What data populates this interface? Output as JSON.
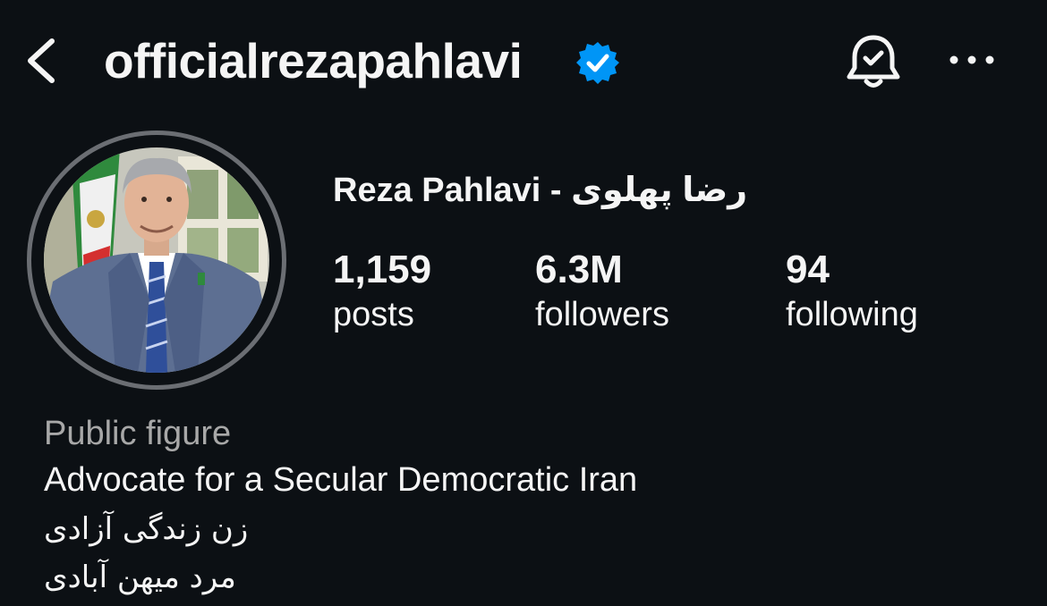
{
  "header": {
    "username": "officialrezapahlavi",
    "verified": true
  },
  "profile": {
    "full_name": "Reza Pahlavi - رضا پهلوی",
    "stats": [
      {
        "value": "1,159",
        "label": "posts"
      },
      {
        "value": "6.3M",
        "label": "followers"
      },
      {
        "value": "94",
        "label": "following"
      }
    ],
    "category": "Public figure",
    "bio_lines": [
      "Advocate for a Secular Democratic Iran",
      "زن زندگی آزادی",
      "مرد میهن آبادی"
    ]
  },
  "colors": {
    "background": "#0c1014",
    "text": "#f5f5f5",
    "secondary_text": "#a8a8a8",
    "verified_blue": "#0095f6",
    "avatar_ring": "#6b6e73"
  },
  "icons": [
    "chevron-left-icon",
    "verified-badge-icon",
    "bell-check-icon",
    "more-horizontal-icon"
  ]
}
